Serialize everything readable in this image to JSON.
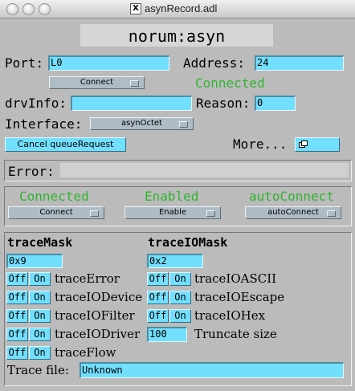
{
  "window": {
    "title": "asynRecord.adl"
  },
  "record": {
    "name": "norum:asyn"
  },
  "port": {
    "label": "Port:",
    "value": "L0"
  },
  "address": {
    "label": "Address:",
    "value": "24"
  },
  "connect_menu": {
    "value": "Connect"
  },
  "connection_status": "Connected",
  "drvinfo": {
    "label": "drvInfo:",
    "value": ""
  },
  "reason": {
    "label": "Reason:",
    "value": "0"
  },
  "interface": {
    "label": "Interface:",
    "value": "asynOctet"
  },
  "cancel_button": "Cancel queueRequest",
  "more": {
    "label": "More...",
    "icon": "window-icon"
  },
  "error": {
    "label": "Error:",
    "value": ""
  },
  "status_panel": {
    "connected": {
      "status": "Connected",
      "menu": "Connect"
    },
    "enabled": {
      "status": "Enabled",
      "menu": "Enable"
    },
    "autoconnect": {
      "status": "autoConnect",
      "menu": "autoConnect"
    }
  },
  "trace": {
    "mask_label": "traceMask",
    "mask_value": "0x9",
    "io_label": "traceIOMask",
    "io_value": "0x2",
    "off": "Off",
    "on": "On",
    "error": "traceError",
    "io_device": "traceIODevice",
    "io_filter": "traceIOFilter",
    "io_driver": "traceIODriver",
    "flow": "traceFlow",
    "io_ascii": "traceIOASCII",
    "io_escape": "traceIOEscape",
    "io_hex": "traceIOHex",
    "truncate_label": "Truncate size",
    "truncate_value": "100",
    "file_label": "Trace file:",
    "file_value": "Unknown"
  },
  "colors": {
    "field": "#73dfff",
    "background": "#bbbbbb",
    "status_green": "#2fb52f",
    "menu": "#aebcc6"
  }
}
